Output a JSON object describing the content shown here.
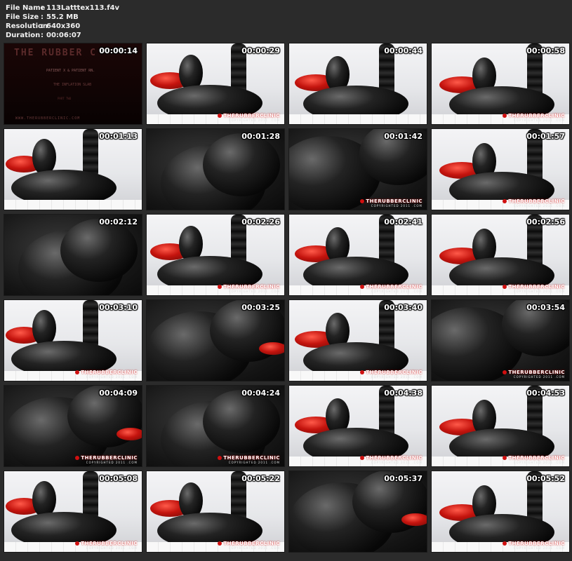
{
  "info": [
    {
      "key": "File Name",
      "sep": ":",
      "value": "113Latttex113.f4v"
    },
    {
      "key": "File Size",
      "sep": ":",
      "value": "55.2 MB"
    },
    {
      "key": "Resolution",
      "sep": ":",
      "value": "640x360"
    },
    {
      "key": "Duration",
      "sep": ":",
      "value": "00:06:07"
    }
  ],
  "title_card": {
    "heading": "THE RUBBER C",
    "line1": "PATIENT X & PATIENT RN.",
    "line2": "THE INFLATION SLAB",
    "line3": "PART TWO",
    "url": "WWW.THERUBBERCLINIC.COM"
  },
  "watermark": {
    "brand": "THERUBBERCLINIC",
    "copyright": "COPYRIGHTED 2011 .COM"
  },
  "thumbnails": [
    {
      "time": "00:00:14",
      "scene": "title",
      "wm": false
    },
    {
      "time": "00:00:29",
      "scene": "light",
      "wm": true
    },
    {
      "time": "00:00:44",
      "scene": "light",
      "wm": false
    },
    {
      "time": "00:00:58",
      "scene": "light",
      "wm": true
    },
    {
      "time": "00:01:13",
      "scene": "light",
      "wm": false
    },
    {
      "time": "00:01:28",
      "scene": "dark",
      "wm": false
    },
    {
      "time": "00:01:42",
      "scene": "dark",
      "wm": true
    },
    {
      "time": "00:01:57",
      "scene": "light",
      "wm": true
    },
    {
      "time": "00:02:12",
      "scene": "dark",
      "wm": false
    },
    {
      "time": "00:02:26",
      "scene": "light",
      "wm": true
    },
    {
      "time": "00:02:41",
      "scene": "light",
      "wm": true
    },
    {
      "time": "00:02:56",
      "scene": "light",
      "wm": true
    },
    {
      "time": "00:03:10",
      "scene": "light",
      "wm": true
    },
    {
      "time": "00:03:25",
      "scene": "dark",
      "wm": false
    },
    {
      "time": "00:03:40",
      "scene": "light",
      "wm": true
    },
    {
      "time": "00:03:54",
      "scene": "dark",
      "wm": true
    },
    {
      "time": "00:04:09",
      "scene": "dark",
      "wm": true
    },
    {
      "time": "00:04:24",
      "scene": "dark",
      "wm": true
    },
    {
      "time": "00:04:38",
      "scene": "light",
      "wm": true
    },
    {
      "time": "00:04:53",
      "scene": "light",
      "wm": true
    },
    {
      "time": "00:05:08",
      "scene": "light",
      "wm": true
    },
    {
      "time": "00:05:22",
      "scene": "light",
      "wm": true
    },
    {
      "time": "00:05:37",
      "scene": "dark",
      "wm": false
    },
    {
      "time": "00:05:52",
      "scene": "light",
      "wm": true
    }
  ]
}
